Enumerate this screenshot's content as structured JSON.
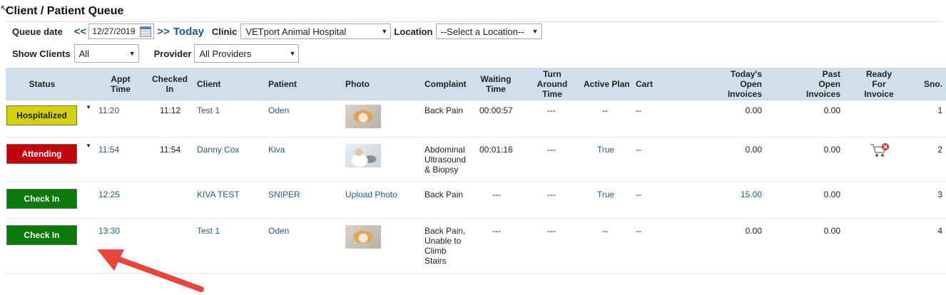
{
  "page": {
    "title": "Client / Patient Queue"
  },
  "filters": {
    "queue_date_label": "Queue date",
    "prev_link": "<<",
    "date_value": "12/27/2019",
    "next_link": ">>",
    "today_link": "Today",
    "clinic_label": "Clinic",
    "clinic_value": "VETport Animal Hospital",
    "location_label": "Location",
    "location_value": "--Select a Location--",
    "show_clients_label": "Show Clients",
    "show_clients_value": "All",
    "provider_label": "Provider",
    "provider_value": "All Providers"
  },
  "table": {
    "headers": {
      "status": "Status",
      "appt_time": [
        "Appt",
        "Time"
      ],
      "checked_in": [
        "Checked",
        "In"
      ],
      "client": "Client",
      "patient": "Patient",
      "photo": "Photo",
      "complaint": "Complaint",
      "waiting_time": [
        "Waiting",
        "Time"
      ],
      "turn_around": [
        "Turn",
        "Around",
        "Time"
      ],
      "active_plan": "Active Plan",
      "cart": "Cart",
      "todays_open": [
        "Today's",
        "Open",
        "Invoices"
      ],
      "past_open": [
        "Past",
        "Open",
        "Invoices"
      ],
      "ready_invoice": [
        "Ready",
        "For",
        "Invoice"
      ],
      "sno": "Sno."
    },
    "rows": [
      {
        "status": "Hospitalized",
        "status_color": "#d4d10a",
        "appt_time": "11:20",
        "checked_in": "11:12",
        "client": "Test 1",
        "patient": "Oden",
        "photo": "dog-photo",
        "complaint": [
          "Back Pain"
        ],
        "waiting_time": "00:00:57",
        "turn_around": "---",
        "active_plan": "--",
        "cart": "--",
        "todays_open": "0.00",
        "past_open": "0.00",
        "ready_invoice": "",
        "sno": "1"
      },
      {
        "status": "Attending",
        "status_color": "#c4000c",
        "appt_time": "11:54",
        "checked_in": "11:54",
        "client": "Danny Cox",
        "patient": "Kiva",
        "photo": "vet-photo",
        "complaint": [
          "Abdominal",
          "Ultrasound",
          "& Biopsy"
        ],
        "waiting_time": "00:01:16",
        "turn_around": "---",
        "active_plan": "True",
        "cart": "--",
        "todays_open": "0.00",
        "past_open": "0.00",
        "ready_invoice": "cart-remove-icon",
        "sno": "2"
      },
      {
        "status": "Check In",
        "status_color": "#0a7a0a",
        "appt_time": "12:25",
        "checked_in": "",
        "client": "KIVA TEST",
        "patient": "SNIPER",
        "photo": "Upload Photo",
        "complaint": [
          "Back Pain"
        ],
        "waiting_time": "---",
        "turn_around": "---",
        "active_plan": "True",
        "cart": "--",
        "todays_open": "15.00",
        "past_open": "0.00",
        "ready_invoice": "",
        "sno": "3"
      },
      {
        "status": "Check In",
        "status_color": "#0a7a0a",
        "appt_time": "13:30",
        "checked_in": "",
        "client": "Test 1",
        "patient": "Oden",
        "photo": "dog-photo",
        "complaint": [
          "Back Pain,",
          "Unable to",
          "Climb",
          "Stairs"
        ],
        "waiting_time": "---",
        "turn_around": "---",
        "active_plan": "--",
        "cart": "--",
        "todays_open": "0.00",
        "past_open": "0.00",
        "ready_invoice": "",
        "sno": "4"
      }
    ]
  },
  "annotation": {
    "arrow_color": "#e8453c"
  }
}
